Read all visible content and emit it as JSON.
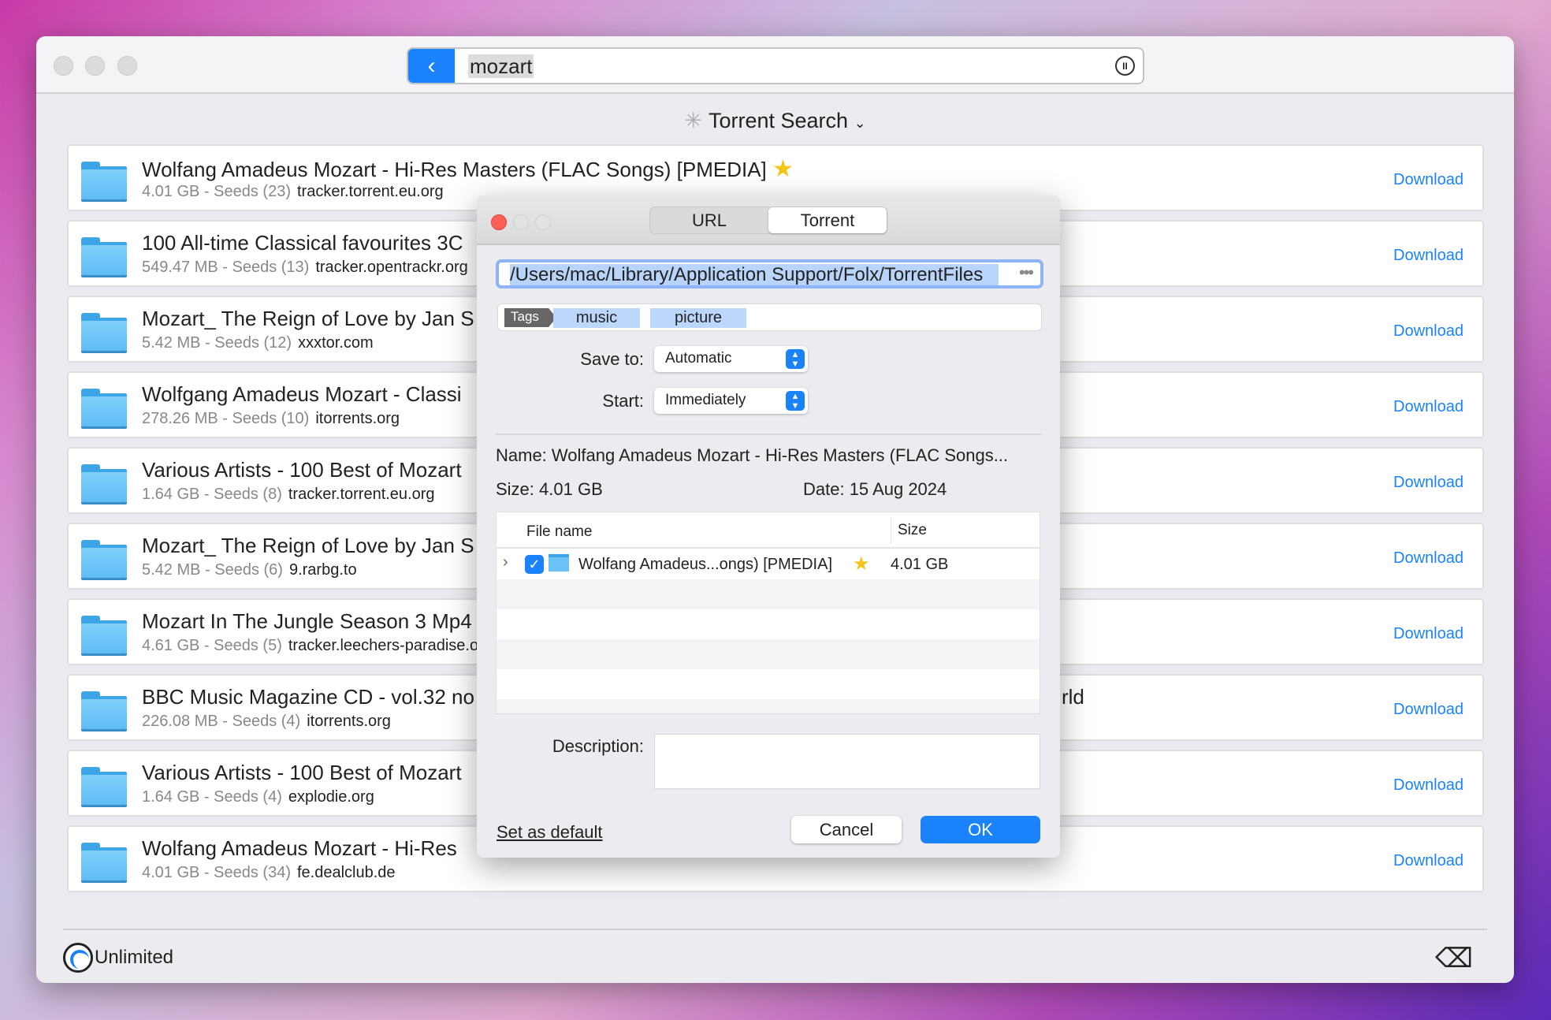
{
  "search": {
    "query": "mozart"
  },
  "source": {
    "label": "Torrent Search"
  },
  "results": [
    {
      "title": "Wolfang Amadeus Mozart - Hi-Res Masters (FLAC Songs) [PMEDIA]",
      "star": true,
      "size": "4.01 GB - Seeds (23)",
      "tracker": "tracker.torrent.eu.org",
      "action": "Download"
    },
    {
      "title": "100 All-time Classical favourites 3C",
      "size": "549.47 MB - Seeds (13)",
      "tracker": "tracker.opentrackr.org",
      "action": "Download"
    },
    {
      "title": "Mozart_ The Reign of Love by Jan S",
      "size": "5.42 MB - Seeds (12)",
      "tracker": "xxxtor.com",
      "action": "Download"
    },
    {
      "title": "Wolfgang Amadeus Mozart - Classi",
      "size": "278.26 MB - Seeds (10)",
      "tracker": "itorrents.org",
      "action": "Download"
    },
    {
      "title": "Various Artists - 100 Best of Mozart",
      "size": "1.64 GB - Seeds (8)",
      "tracker": "tracker.torrent.eu.org",
      "action": "Download"
    },
    {
      "title": "Mozart_ The Reign of Love by Jan S",
      "size": "5.42 MB - Seeds (6)",
      "tracker": "9.rarbg.to",
      "action": "Download"
    },
    {
      "title": "Mozart In The Jungle Season 3 Mp4",
      "size": "4.61 GB - Seeds (5)",
      "tracker": "tracker.leechers-paradise.org",
      "action": "Download"
    },
    {
      "title": "BBC Music Magazine CD - vol.32 no",
      "tail": "rld",
      "size": "226.08 MB - Seeds (4)",
      "tracker": "itorrents.org",
      "action": "Download"
    },
    {
      "title": "Various Artists - 100 Best of Mozart",
      "size": "1.64 GB - Seeds (4)",
      "tracker": "explodie.org",
      "action": "Download"
    },
    {
      "title": "Wolfang Amadeus Mozart - Hi-Res",
      "size": "4.01 GB - Seeds (34)",
      "tracker": "fe.dealclub.de",
      "action": "Download"
    }
  ],
  "footer": {
    "speed": "Unlimited"
  },
  "dialog": {
    "tabs": [
      "URL",
      "Torrent"
    ],
    "active_tab": "Torrent",
    "path": "/Users/mac/Library/Application Support/Folx/TorrentFiles",
    "path_more": "•••",
    "tags_label": "Tags",
    "tags": [
      "music",
      "picture"
    ],
    "save_to_label": "Save to:",
    "save_to_value": "Automatic",
    "start_label": "Start:",
    "start_value": "Immediately",
    "name": "Name: Wolfang Amadeus Mozart - Hi-Res Masters (FLAC Songs...",
    "size": "Size: 4.01 GB",
    "date": "Date: 15 Aug 2024",
    "table": {
      "headers": [
        "File name",
        "Size"
      ],
      "rows": [
        {
          "name": "Wolfang Amadeus...ongs) [PMEDIA]",
          "size": "4.01 GB",
          "checked": true
        }
      ]
    },
    "description_label": "Description:",
    "description": "",
    "set_default": "Set as default",
    "cancel": "Cancel",
    "ok": "OK"
  },
  "colors": {
    "accent": "#1a82fb",
    "close": "#fe5f57"
  }
}
